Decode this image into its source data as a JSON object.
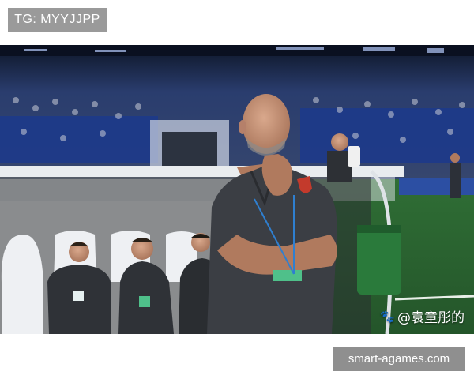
{
  "top_tag": {
    "text": "TG: MYYJJPP"
  },
  "photo": {
    "watermark_text": "@袁童彤的",
    "watermark_icon": "paw-icon"
  },
  "bottom_tag": {
    "text": "smart-agames.com"
  },
  "colors": {
    "tag_bg": "#9a9a9a",
    "pitch": "#2e6b35",
    "stadium_blue": "#1f3f8c",
    "shirt": "#3b3e44"
  }
}
